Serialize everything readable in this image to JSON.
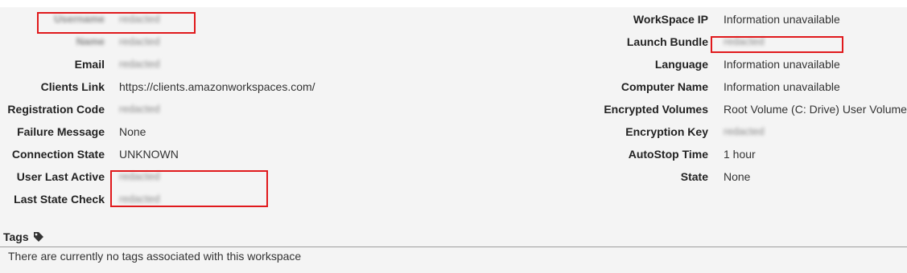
{
  "details": {
    "left": [
      {
        "label": "Username",
        "value": "redacted"
      },
      {
        "label": "Name",
        "value": "redacted"
      },
      {
        "label": "Email",
        "value": "redacted"
      },
      {
        "label": "Clients Link",
        "value": "https://clients.amazonworkspaces.com/"
      },
      {
        "label": "Registration Code",
        "value": "redacted"
      },
      {
        "label": "Failure Message",
        "value": "None"
      },
      {
        "label": "Connection State",
        "value": "UNKNOWN"
      },
      {
        "label": "User Last Active",
        "value": "redacted"
      },
      {
        "label": "Last State Check",
        "value": "redacted"
      }
    ],
    "right": [
      {
        "label": "WorkSpace IP",
        "value": "Information unavailable"
      },
      {
        "label": "Launch Bundle",
        "value": "redacted"
      },
      {
        "label": "Language",
        "value": "Information unavailable"
      },
      {
        "label": "Computer Name",
        "value": "Information unavailable"
      },
      {
        "label": "Encrypted Volumes",
        "value": "Root Volume (C: Drive) User Volume"
      },
      {
        "label": "Encryption Key",
        "value": "redacted"
      },
      {
        "label": "AutoStop Time",
        "value": "1 hour"
      },
      {
        "label": "State",
        "value": "None"
      }
    ]
  },
  "tags": {
    "title": "Tags",
    "icon": "tag-icon",
    "empty_message": "There are currently no tags associated with this workspace"
  },
  "colors": {
    "highlight": "#e0191c",
    "panel_background": "#f4f4f4"
  }
}
